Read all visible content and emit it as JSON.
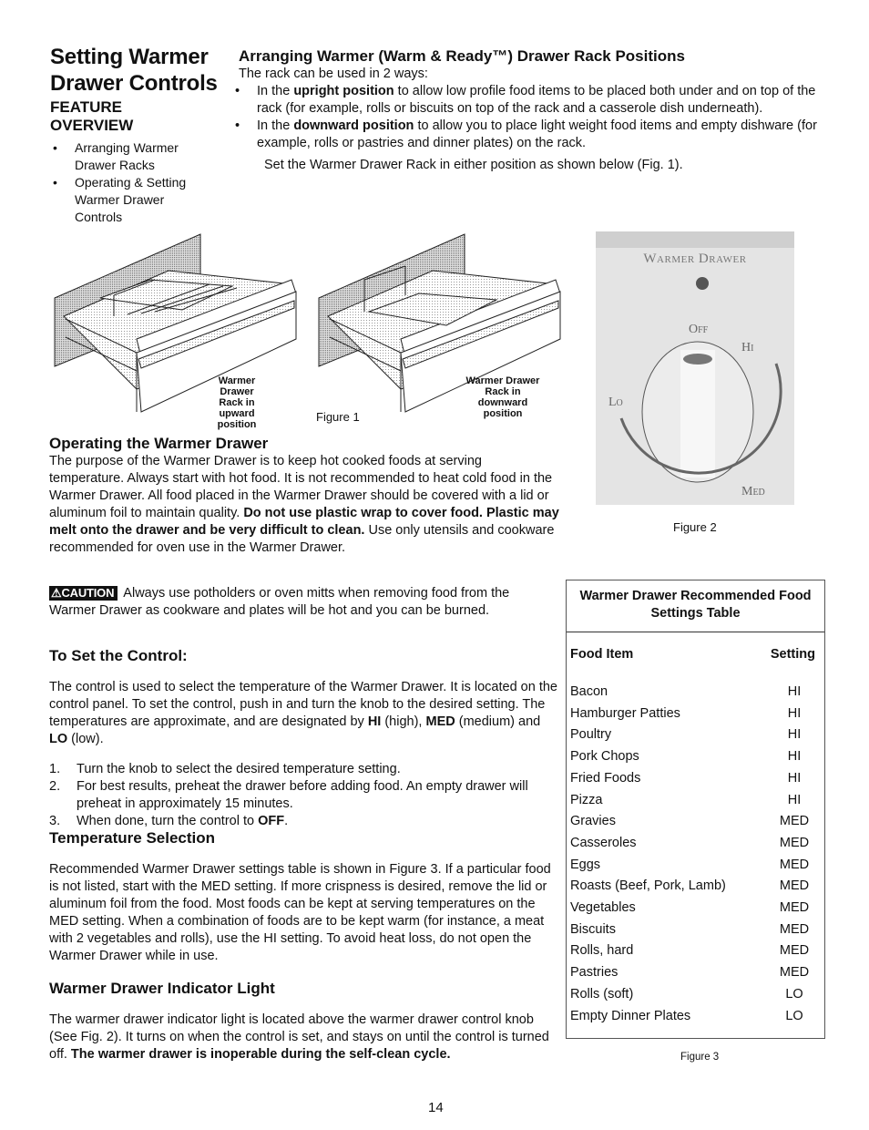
{
  "sidebar": {
    "title_line1": "Setting Warmer",
    "title_line2": "Drawer Controls",
    "feature_line1": "FEATURE",
    "feature_line2": "OVERVIEW",
    "items": [
      "Arranging Warmer Drawer Racks",
      "Operating & Setting Warmer Drawer Controls"
    ]
  },
  "arranging": {
    "heading": "Arranging Warmer (Warm & Ready™) Drawer Rack Positions",
    "intro": "The rack can be used in 2 ways:",
    "bullets": [
      {
        "pre": "In the ",
        "bold": "upright position",
        "post": " to allow low profile food items to be placed both under and on top of the rack (for example, rolls or biscuits on top of the rack and a casserole dish underneath)."
      },
      {
        "pre": "In the ",
        "bold": "downward position",
        "post": " to allow you to place light weight food items and empty dishware (for example, rolls or pastries and dinner plates) on the rack."
      }
    ],
    "closing": "Set the Warmer Drawer Rack in either position as shown below (Fig. 1)."
  },
  "figure1": {
    "caption": "Figure 1",
    "left_label": [
      "Warmer Drawer",
      "Rack in upward",
      "position"
    ],
    "right_label": [
      "Warmer Drawer",
      "Rack in downward",
      "position"
    ]
  },
  "figure2": {
    "caption": "Figure 2",
    "panel_label": "Warmer Drawer",
    "knob_labels": {
      "off": "Off",
      "hi": "Hi",
      "lo": "Lo",
      "med": "Med"
    }
  },
  "operating": {
    "heading": "Operating the Warmer Drawer",
    "text_pre": "The purpose of the Warmer Drawer is to keep hot cooked foods at serving temperature. Always start with hot food. It is not recommended to heat cold food in the Warmer Drawer. All food placed in the Warmer Drawer should be covered with a lid or aluminum foil to maintain quality.  ",
    "text_bold": "Do not use plastic wrap to cover food. Plastic may melt onto the drawer and be very difficult to clean.",
    "text_post": " Use only utensils and cookware recommended for oven use in the Warmer Drawer."
  },
  "caution": {
    "badge": "CAUTION",
    "text": "Always use potholders or oven mitts when removing food from the Warmer Drawer as cookware and plates will be hot and you can be burned."
  },
  "set_control": {
    "heading": "To Set the Control:",
    "text": "The control is used to select the temperature of the Warmer Drawer. It is located on the control panel. To set the control, push in and turn the knob to the desired setting. The temperatures are approximate, and are designated by ",
    "hi": "HI",
    "hi_desc": " (high), ",
    "med": "MED",
    "med_desc": " (medium) and ",
    "lo": "LO",
    "lo_desc": " (low).",
    "steps": [
      {
        "num": "1.",
        "text": "Turn the knob to select the desired temperature setting."
      },
      {
        "num": "2.",
        "text": "For best results, preheat the drawer before adding food. An empty drawer will preheat in approximately 15 minutes."
      },
      {
        "num": "3.",
        "text": "When done, turn the control to ",
        "bold": "OFF",
        "post": "."
      }
    ]
  },
  "temperature": {
    "heading": "Temperature Selection",
    "text": "Recommended Warmer Drawer settings table is shown in Figure 3. If a particular food is not listed, start with the MED setting. If more crispness is desired, remove the lid or aluminum foil from the food. Most foods can be kept at serving temperatures on the MED setting. When a combination of foods are to be kept warm (for instance, a meat with 2 vegetables and rolls), use the HI setting. To avoid heat loss, do not open the Warmer Drawer while in use."
  },
  "indicator": {
    "heading": "Warmer Drawer Indicator Light",
    "text": "The warmer drawer indicator light is located above the warmer drawer control knob (See Fig. 2). It turns on when the control is set, and stays on until the control is turned off. ",
    "bold": "The warmer drawer is inoperable during the self-clean cycle."
  },
  "table": {
    "title": "Warmer Drawer Recommended Food Settings Table",
    "col_food": "Food Item",
    "col_setting": "Setting",
    "rows": [
      {
        "food": "Bacon",
        "setting": "HI"
      },
      {
        "food": "Hamburger Patties",
        "setting": "HI"
      },
      {
        "food": "Poultry",
        "setting": "HI"
      },
      {
        "food": "Pork Chops",
        "setting": "HI"
      },
      {
        "food": "Fried Foods",
        "setting": "HI"
      },
      {
        "food": "Pizza",
        "setting": "HI"
      },
      {
        "food": "Gravies",
        "setting": "MED"
      },
      {
        "food": "Casseroles",
        "setting": "MED"
      },
      {
        "food": "Eggs",
        "setting": "MED"
      },
      {
        "food": "Roasts (Beef, Pork, Lamb)",
        "setting": "MED"
      },
      {
        "food": "Vegetables",
        "setting": "MED"
      },
      {
        "food": "Biscuits",
        "setting": "MED"
      },
      {
        "food": "Rolls, hard",
        "setting": "MED"
      },
      {
        "food": "Pastries",
        "setting": "MED"
      },
      {
        "food": "Rolls (soft)",
        "setting": "LO"
      },
      {
        "food": "Empty Dinner Plates",
        "setting": "LO"
      }
    ],
    "caption": "Figure 3"
  },
  "page_number": "14"
}
